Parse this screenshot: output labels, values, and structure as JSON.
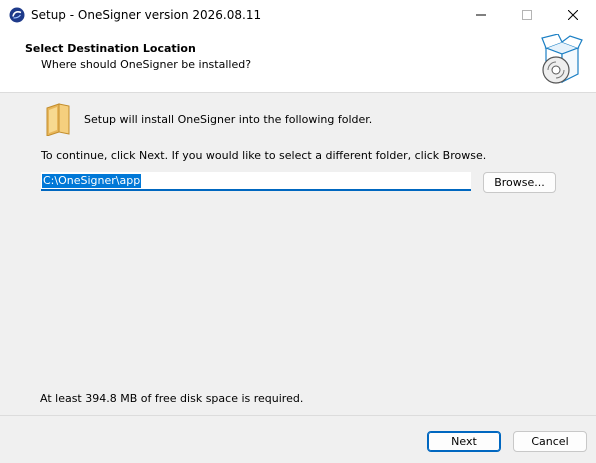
{
  "window": {
    "title": "Setup - OneSigner version 2026.08.11",
    "controls": {
      "minimize": "minimize-icon",
      "maximize": "maximize-icon",
      "close": "close-icon"
    }
  },
  "header": {
    "title": "Select Destination Location",
    "subtitle": "Where should OneSigner be installed?",
    "image": "software-box-disc-icon"
  },
  "body": {
    "info": "Setup will install OneSigner into the following folder.",
    "instruction": "To continue, click Next. If you would like to select a different folder, click Browse.",
    "path_value": "C:\\OneSigner\\app",
    "browse_label": "Browse...",
    "disk_space": "At least 394.8 MB of free disk space is required."
  },
  "footer": {
    "next_label": "Next",
    "cancel_label": "Cancel"
  },
  "colors": {
    "accent": "#0067c0",
    "selection": "#0078d7"
  }
}
